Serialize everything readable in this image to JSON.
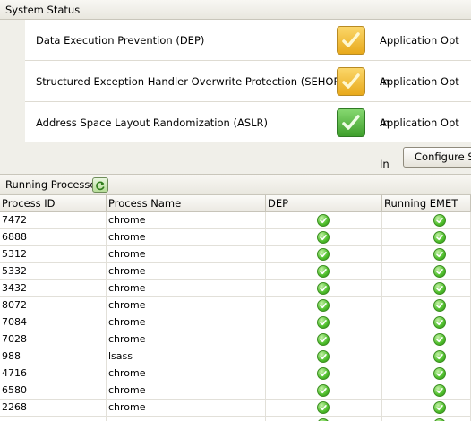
{
  "system_status": {
    "title": "System Status",
    "rows": [
      {
        "name": "Data Execution Prevention (DEP)",
        "status": "Application Opt In",
        "indicator": "check-warning",
        "color": "#e8a91b"
      },
      {
        "name": "Structured Exception Handler Overwrite Protection (SEHOP)",
        "status": "Application Opt In",
        "indicator": "check-warning",
        "color": "#e8a91b"
      },
      {
        "name": "Address Space Layout Randomization (ASLR)",
        "status": "Application Opt In",
        "indicator": "check-ok",
        "color": "#3f9f2c"
      }
    ],
    "configure_button": "Configure System"
  },
  "running_processes": {
    "title": "Running Processes",
    "refresh_icon": "refresh-icon",
    "columns": [
      "Process ID",
      "Process Name",
      "DEP",
      "Running EMET"
    ],
    "rows": [
      {
        "pid": "7472",
        "name": "chrome",
        "dep": "enabled",
        "emet": "running"
      },
      {
        "pid": "6888",
        "name": "chrome",
        "dep": "enabled",
        "emet": "running"
      },
      {
        "pid": "5312",
        "name": "chrome",
        "dep": "enabled",
        "emet": "running"
      },
      {
        "pid": "5332",
        "name": "chrome",
        "dep": "enabled",
        "emet": "running"
      },
      {
        "pid": "3432",
        "name": "chrome",
        "dep": "enabled",
        "emet": "running"
      },
      {
        "pid": "8072",
        "name": "chrome",
        "dep": "enabled",
        "emet": "running"
      },
      {
        "pid": "7084",
        "name": "chrome",
        "dep": "enabled",
        "emet": "running"
      },
      {
        "pid": "7028",
        "name": "chrome",
        "dep": "enabled",
        "emet": "running"
      },
      {
        "pid": "988",
        "name": "lsass",
        "dep": "enabled",
        "emet": "running"
      },
      {
        "pid": "4716",
        "name": "chrome",
        "dep": "enabled",
        "emet": "running"
      },
      {
        "pid": "6580",
        "name": "chrome",
        "dep": "enabled",
        "emet": "running"
      },
      {
        "pid": "2268",
        "name": "chrome",
        "dep": "enabled",
        "emet": "running"
      },
      {
        "pid": "",
        "name": "",
        "dep": "enabled",
        "emet": "running"
      }
    ]
  }
}
